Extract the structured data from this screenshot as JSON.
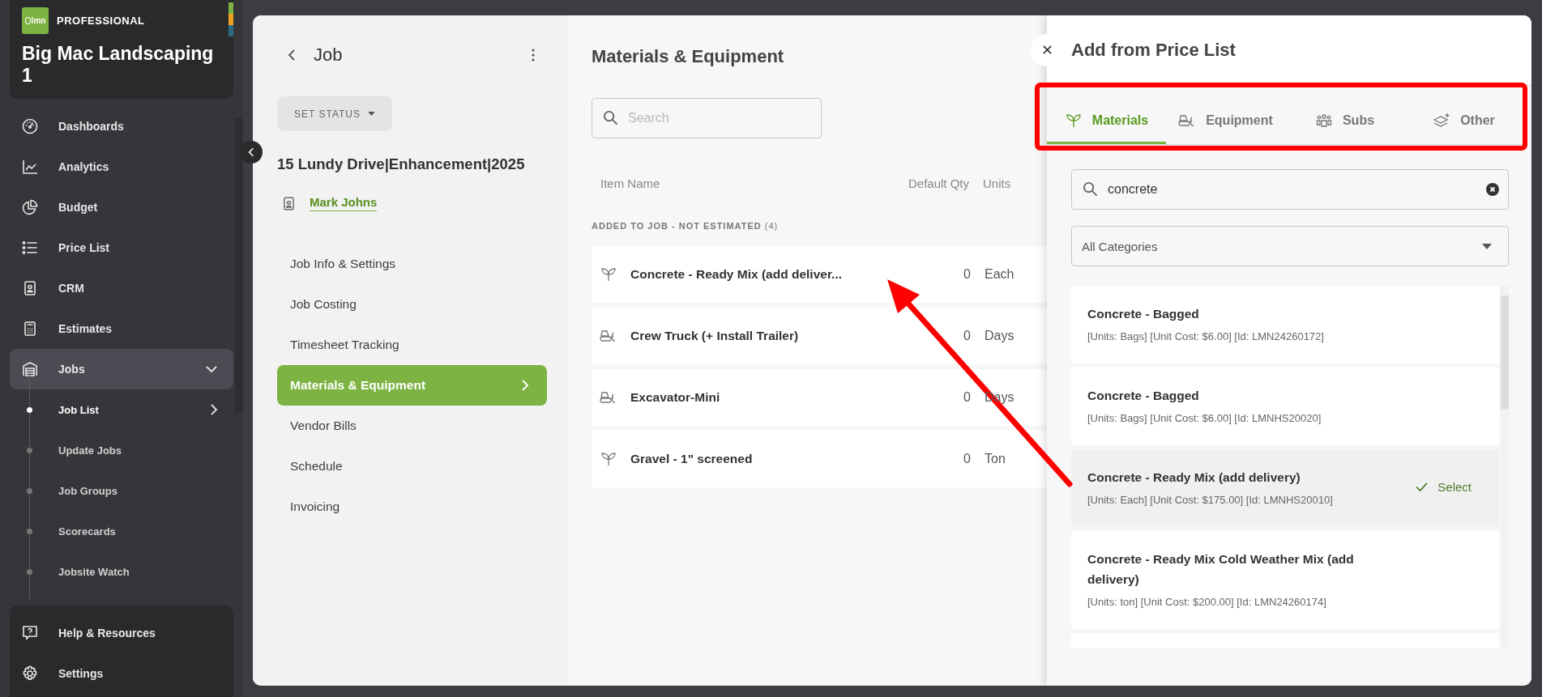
{
  "sidebar": {
    "logo": "lmn",
    "edition": "PROFESSIONAL",
    "company": "Big Mac Landscaping 1",
    "nav": [
      {
        "label": "Dashboards",
        "selected": false,
        "expanded": false
      },
      {
        "label": "Analytics",
        "selected": false,
        "expanded": false
      },
      {
        "label": "Budget",
        "selected": false,
        "expanded": false
      },
      {
        "label": "Price List",
        "selected": false,
        "expanded": false
      },
      {
        "label": "CRM",
        "selected": false,
        "expanded": false
      },
      {
        "label": "Estimates",
        "selected": false,
        "expanded": false
      },
      {
        "label": "Jobs",
        "selected": true,
        "expanded": true,
        "children": [
          {
            "label": "Job List",
            "selected": true
          },
          {
            "label": "Update Jobs",
            "selected": false
          },
          {
            "label": "Job Groups",
            "selected": false
          },
          {
            "label": "Scorecards",
            "selected": false
          },
          {
            "label": "Jobsite Watch",
            "selected": false
          }
        ]
      }
    ],
    "footer": [
      {
        "label": "Help & Resources"
      },
      {
        "label": "Settings"
      }
    ]
  },
  "job": {
    "title": "Job",
    "status_button": "SET STATUS",
    "address": "15 Lundy Drive|Enhancement|2025",
    "contact": "Mark Johns",
    "menu": [
      {
        "label": "Job Info & Settings",
        "selected": false
      },
      {
        "label": "Job Costing",
        "selected": false
      },
      {
        "label": "Timesheet Tracking",
        "selected": false
      },
      {
        "label": "Materials & Equipment",
        "selected": true
      },
      {
        "label": "Vendor Bills",
        "selected": false
      },
      {
        "label": "Schedule",
        "selected": false
      },
      {
        "label": "Invoicing",
        "selected": false
      }
    ]
  },
  "materials": {
    "title": "Materials & Equipment",
    "search": {
      "placeholder": "Search"
    },
    "columns": [
      "Item Name",
      "Default Qty",
      "Units"
    ],
    "section": {
      "label": "ADDED TO JOB - NOT ESTIMATED",
      "count": "(4)"
    },
    "rows": [
      {
        "kind": "material",
        "name": "Concrete - Ready Mix (add deliver...",
        "qty": "0",
        "units": "Each"
      },
      {
        "kind": "equipment",
        "name": "Crew Truck (+ Install Trailer)",
        "qty": "0",
        "units": "Days"
      },
      {
        "kind": "equipment",
        "name": "Excavator-Mini",
        "qty": "0",
        "units": "Days"
      },
      {
        "kind": "material",
        "name": "Gravel - 1\" screened",
        "qty": "0",
        "units": "Ton"
      }
    ]
  },
  "price_list": {
    "title": "Add from Price List",
    "tabs": [
      {
        "label": "Materials",
        "selected": true
      },
      {
        "label": "Equipment",
        "selected": false
      },
      {
        "label": "Subs",
        "selected": false
      },
      {
        "label": "Other",
        "selected": false
      }
    ],
    "search": {
      "value": "concrete"
    },
    "category": "All Categories",
    "items": [
      {
        "title": "Concrete - Bagged",
        "details": "[Units: Bags] [Unit Cost: $6.00] [Id: LMN24260172]",
        "highlighted": false
      },
      {
        "title": "Concrete - Bagged",
        "details": "[Units: Bags] [Unit Cost: $6.00] [Id: LMNHS20020]",
        "highlighted": false
      },
      {
        "title": "Concrete - Ready Mix (add delivery)",
        "details": "[Units: Each] [Unit Cost: $175.00] [Id: LMNHS20010]",
        "highlighted": true,
        "action": "Select"
      },
      {
        "title": "Concrete - Ready Mix Cold Weather Mix (add delivery)",
        "details": "[Units: ton] [Unit Cost: $200.00] [Id: LMN24260174]",
        "highlighted": false
      }
    ]
  }
}
